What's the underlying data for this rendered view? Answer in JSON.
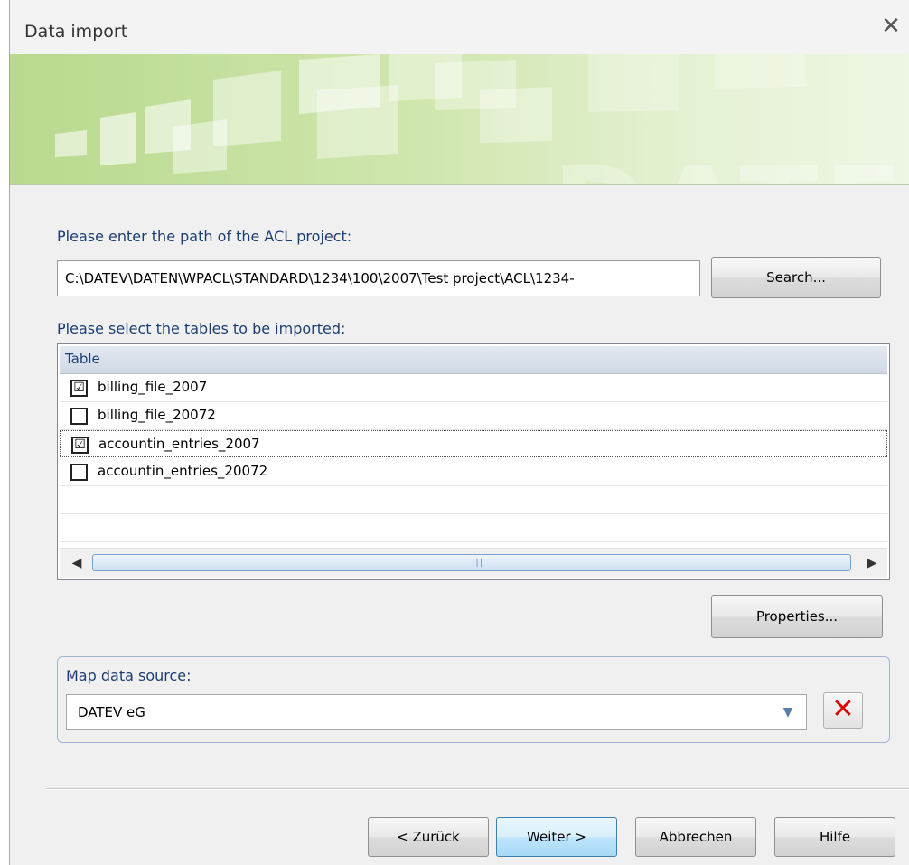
{
  "window": {
    "title": "Data import"
  },
  "banner": {
    "brand_text": "DATEV"
  },
  "path_section": {
    "label": "Please enter the path of the ACL project:",
    "path_value": "C:\\DATEV\\DATEN\\WPACL\\STANDARD\\1234\\100\\2007\\Test project\\ACL\\1234-",
    "search_button": "Search..."
  },
  "tables_section": {
    "label": "Please select the tables to be imported:",
    "column_header": "Table",
    "rows": [
      {
        "name": "billing_file_2007",
        "checked": true,
        "check_glyph": "☑"
      },
      {
        "name": "billing_file_20072",
        "checked": false,
        "check_glyph": ""
      },
      {
        "name": "accountin_entries_2007",
        "checked": true,
        "check_glyph": "☑"
      },
      {
        "name": "accountin_entries_20072",
        "checked": false,
        "check_glyph": ""
      }
    ],
    "properties_button": "Properties..."
  },
  "map_section": {
    "label": "Map data source:",
    "value": "DATEV eG"
  },
  "footer": {
    "back_button": "< Zurück",
    "next_button": "Weiter >",
    "cancel_button": "Abbrechen",
    "help_button": "Hilfe"
  },
  "icons": {
    "close": "close-icon",
    "dropdown": "chevron-down-icon",
    "clear": "red-x-icon",
    "checkbox": "checkbox-icon",
    "scroll_left": "arrow-left-icon",
    "scroll_right": "arrow-right-icon"
  },
  "colors": {
    "label_text": "#1c3d72",
    "banner_green": "#b9d98e",
    "clear_red": "#e00000",
    "focus_button_border": "#3c7fb1"
  }
}
